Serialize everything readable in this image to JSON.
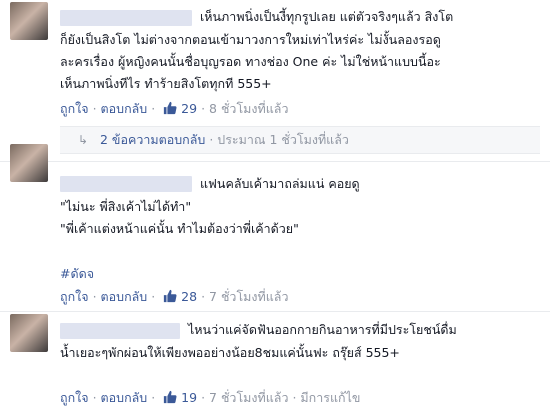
{
  "comments": [
    {
      "lines": [
        "เห็นภาพนิ่งเป็นงี้ทุกรูปเลย แต่ตัวจริงๆแล้ว สิงโต",
        "ก็ยังเป็นสิงโต ไม่ต่างจากตอนเข้ามาวงการใหม่เท่าไหร่ค่ะ ไม่งั้นลองรอดู",
        "ละครเรื่อง ผู้หญิงคนนั้นชื่อบุญรอด ทางช่อง One ค่ะ ไม่ใช่หน้าแบบนี้อะ",
        "เห็นภาพนิ่งทีไร ทำร้ายสิงโตทุกที 555+"
      ],
      "like_label": "ถูกใจ",
      "reply_label": "ตอบกลับ",
      "likes": "29",
      "time": "8 ชั่วโมงที่แล้ว",
      "replies_link": "2 ข้อความตอบกลับ",
      "replies_time": "ประมาณ 1 ชั่วโมงที่แล้ว"
    },
    {
      "lines": [
        "แฟนคลับเค้ามาถล่มแน่ คอยดู",
        "\"ไม่นะ พี่สิงเค้าไม่ได้ทำ\"",
        "\"พี่เค้าแต่งหน้าแค่นั้น ทำไมต้องว่าพี่เค้าด้วย\""
      ],
      "hashtag": "#ดัดจ",
      "like_label": "ถูกใจ",
      "reply_label": "ตอบกลับ",
      "likes": "28",
      "time": "7 ชั่วโมงที่แล้ว"
    },
    {
      "lines": [
        "ไหนว่าแค่จัดฟันออกกายกินอาหารที่มีประโยชน์ดื่ม",
        "น้ำเยอะๆพักผ่อนให้เพียงพออย่างน้อย8ชมแค่นั้นฟะ ถรุ๊ยส์ 555+"
      ],
      "like_label": "ถูกใจ",
      "reply_label": "ตอบกลับ",
      "likes": "19",
      "time": "7 ชั่วโมงที่แล้ว",
      "edited": "มีการแก้ไข"
    }
  ],
  "colors": {
    "link": "#3b5998",
    "meta": "#9197a3",
    "text": "#141823"
  },
  "icons": {
    "like": "thumbs-up-icon",
    "replies": "reply-arrow-icon"
  }
}
